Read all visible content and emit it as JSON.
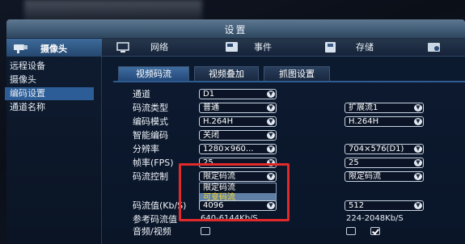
{
  "window": {
    "title": "设置"
  },
  "sidebar": {
    "header": "摄像头",
    "items": [
      {
        "label": "远程设备"
      },
      {
        "label": "摄像头"
      },
      {
        "label": "编码设置"
      },
      {
        "label": "通道名称"
      }
    ]
  },
  "topnav": {
    "items": [
      {
        "label": "网络"
      },
      {
        "label": "事件"
      },
      {
        "label": "存储"
      }
    ]
  },
  "tabs": [
    {
      "label": "视频码流"
    },
    {
      "label": "视频叠加"
    },
    {
      "label": "抓图设置"
    }
  ],
  "form": {
    "rows": [
      {
        "label": "通道",
        "main": "D1"
      },
      {
        "label": "码流类型",
        "main": "普通",
        "sub": "扩展流1"
      },
      {
        "label": "编码模式",
        "main": "H.264H",
        "sub": "H.264H"
      },
      {
        "label": "智能编码",
        "main": "关闭"
      },
      {
        "label": "分辨率",
        "main": "1280×960...",
        "sub": "704×576(D1)"
      },
      {
        "label": "帧率(FPS)",
        "main": "25",
        "sub": "25"
      },
      {
        "label": "码流控制",
        "main": "限定码流",
        "sub": "限定码流"
      },
      {
        "label": "码流值(Kb/S)",
        "main": "4096",
        "sub": "512"
      },
      {
        "label": "参考码流值",
        "main": "640-6144Kb/S",
        "sub": "224-2048Kb/S"
      },
      {
        "label": "音频/视频"
      }
    ]
  },
  "dropdown": {
    "options": [
      {
        "label": "限定码流"
      },
      {
        "label": "可变码流"
      }
    ],
    "highlighted": "可变码流"
  },
  "colors": {
    "accent": "#2c5d96",
    "highlight_text": "#ffdd33",
    "annotation_box": "#e22a2a"
  }
}
